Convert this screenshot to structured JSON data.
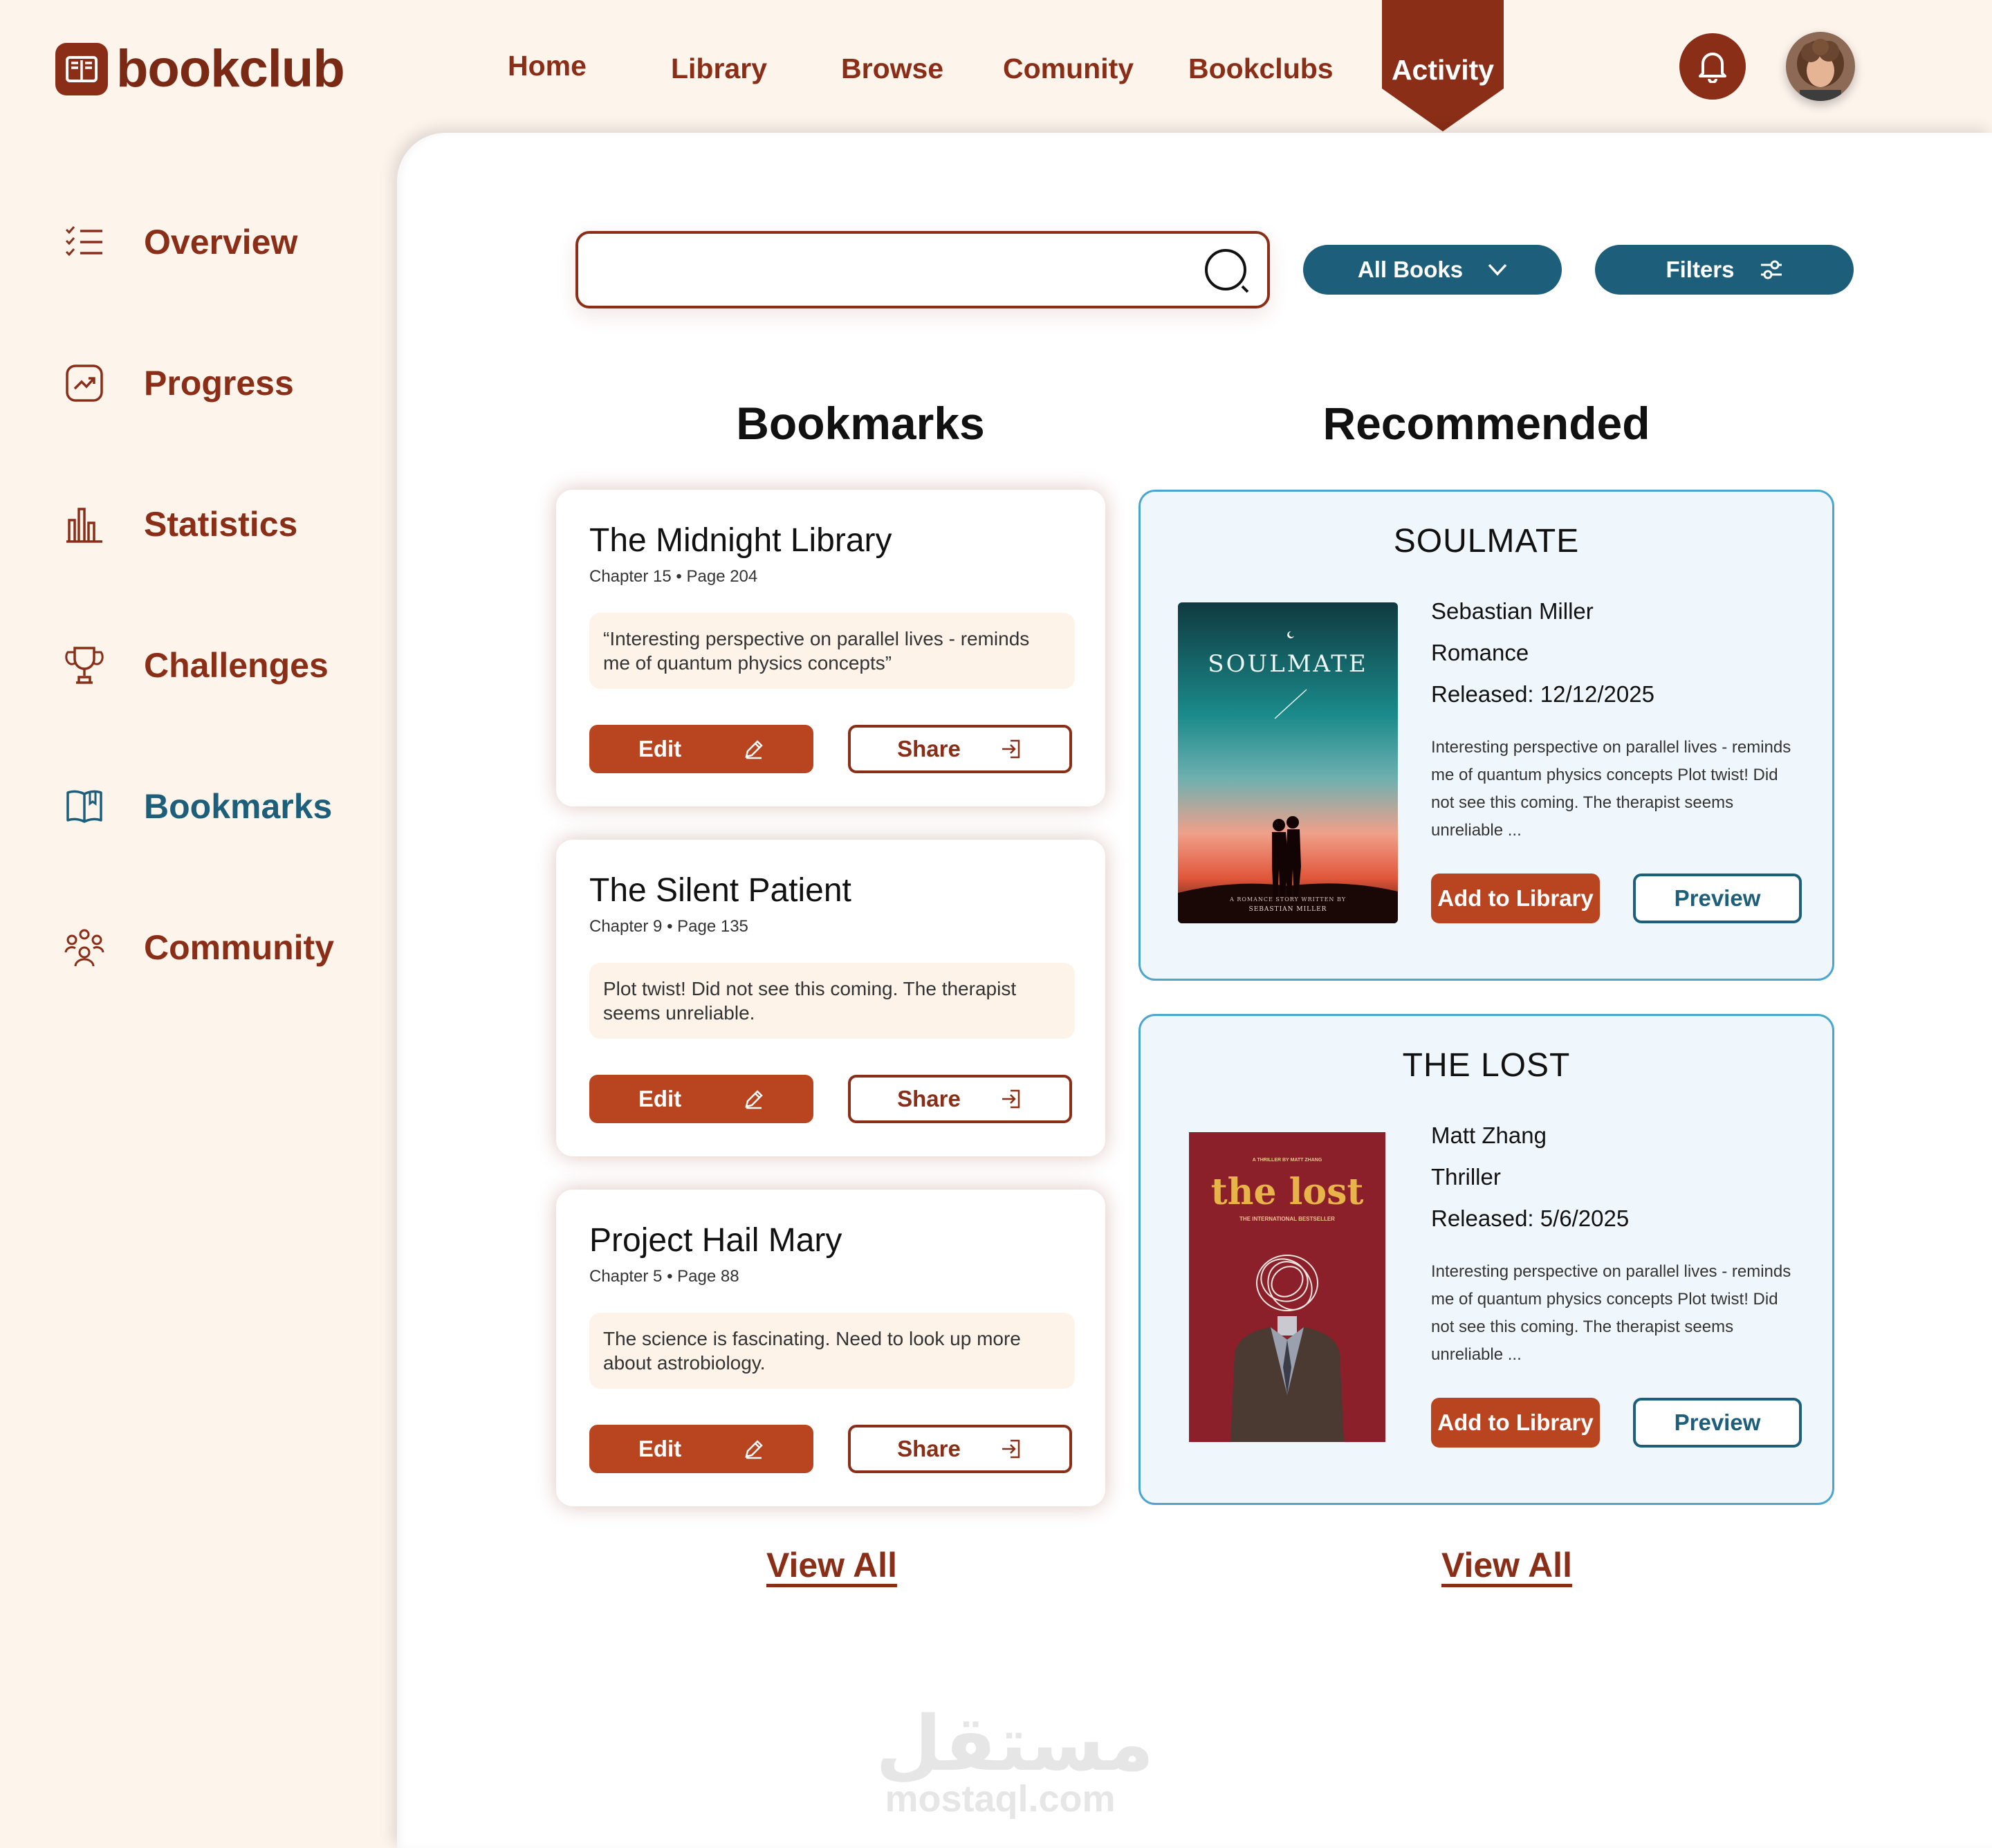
{
  "app": {
    "name": "bookclub",
    "accent": "#8a2e17",
    "action": "#b84420",
    "secondary": "#1d5f7a",
    "background": "#fdf4ec"
  },
  "nav": {
    "items": [
      "Home",
      "Library",
      "Browse",
      "Comunity",
      "Bookclubs"
    ],
    "active": "Activity"
  },
  "sidebar": {
    "items": [
      {
        "label": "Overview",
        "icon": "list-check-icon"
      },
      {
        "label": "Progress",
        "icon": "trend-chart-icon"
      },
      {
        "label": "Statistics",
        "icon": "bar-chart-icon"
      },
      {
        "label": "Challenges",
        "icon": "trophy-icon"
      },
      {
        "label": "Bookmarks",
        "icon": "open-book-icon"
      },
      {
        "label": "Community",
        "icon": "people-icon"
      }
    ],
    "active": "Bookmarks"
  },
  "search": {
    "value": "",
    "placeholder": ""
  },
  "filters": {
    "books_label": "All Books",
    "filters_label": "Filters"
  },
  "bookmarks": {
    "title": "Bookmarks",
    "view_all": "View All",
    "edit_label": "Edit",
    "share_label": "Share",
    "items": [
      {
        "title": "The Midnight Library",
        "meta": "Chapter 15 • Page 204",
        "note": "“Interesting perspective on parallel lives - reminds me of quantum physics concepts”"
      },
      {
        "title": "The Silent Patient",
        "meta": "Chapter 9 • Page 135",
        "note": "Plot twist! Did not see this coming. The therapist seems unreliable."
      },
      {
        "title": "Project Hail Mary",
        "meta": "Chapter 5 • Page 88",
        "note": "The science is fascinating. Need to look up more about astrobiology."
      }
    ]
  },
  "recommended": {
    "title": "Recommended",
    "view_all": "View All",
    "add_label": "Add to Library",
    "preview_label": "Preview",
    "items": [
      {
        "title": "SOULMATE",
        "author": "Sebastian Miller",
        "genre": "Romance",
        "released": "Released: 12/12/2025",
        "description": "Interesting perspective on parallel lives - reminds me of quantum physics concepts Plot twist! Did not see this coming. The therapist seems unreliable ...",
        "cover_title": "SOULMATE",
        "cover_subtitle": "A ROMANCE STORY WRITTEN BY",
        "cover_author": "SEBASTIAN MILLER"
      },
      {
        "title": "THE LOST",
        "author": "Matt Zhang",
        "genre": "Thriller",
        "released": "Released: 5/6/2025",
        "description": "Interesting perspective on parallel lives - reminds me of quantum physics concepts Plot twist! Did not see this coming. The therapist seems unreliable ...",
        "cover_kicker": "A THRILLER BY MATT ZHANG",
        "cover_title": "the lost",
        "cover_tagline": "THE INTERNATIONAL BESTSELLER"
      }
    ]
  },
  "watermark": {
    "arabic": "مستقل",
    "latin": "mostaql.com"
  }
}
